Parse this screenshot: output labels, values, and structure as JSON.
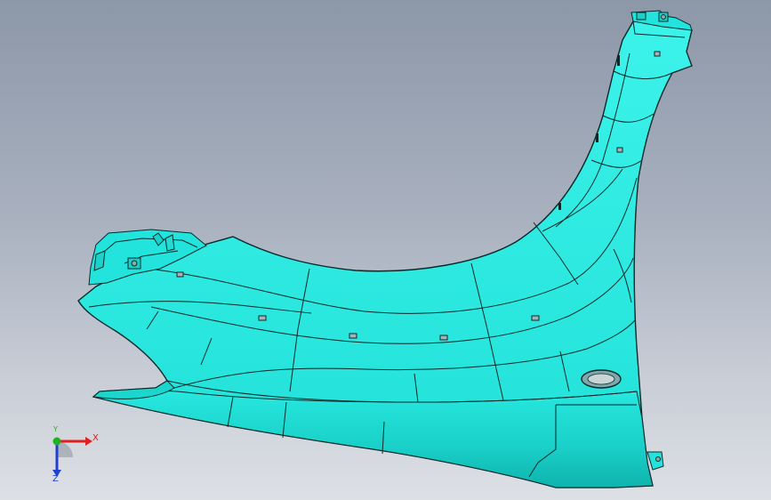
{
  "viewport": {
    "background_top": "#8c97a8",
    "background_bottom": "#dde0e5"
  },
  "model": {
    "part": "front-fender",
    "surface_color": "#2ef0e6",
    "shade_color": "#18c9c2",
    "edge_color": "#0a2a2a"
  },
  "triad": {
    "x_label": "X",
    "y_label": "Y",
    "z_label": "Z",
    "x_color": "#e02020",
    "y_color": "#20b020",
    "z_color": "#2040d0"
  }
}
